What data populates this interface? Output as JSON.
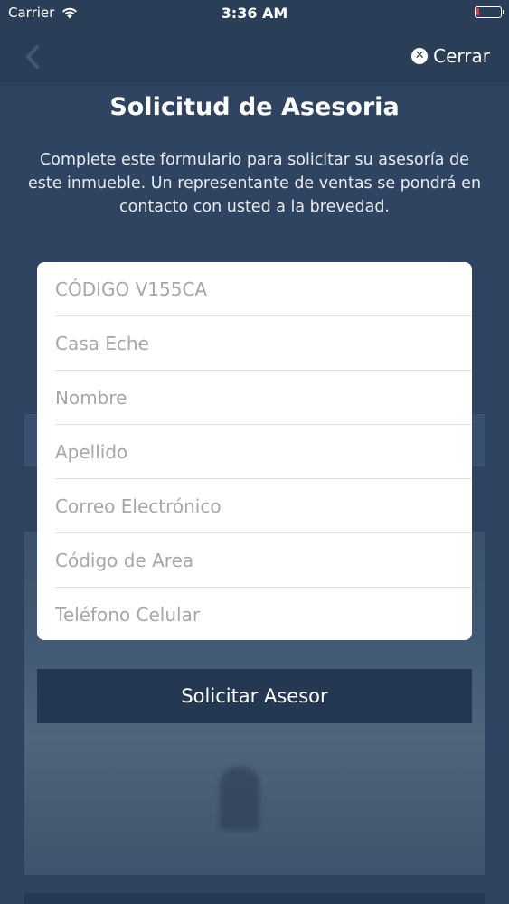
{
  "status_bar": {
    "carrier": "Carrier",
    "time": "3:36 AM",
    "battery_level": 0.1
  },
  "nav": {
    "close_label": "Cerrar",
    "back_icon": "chevron-left-icon",
    "close_icon": "close-circle-icon"
  },
  "header": {
    "title": "Solicitud de Asesoria",
    "description": "Complete este formulario para solicitar su asesoría de este inmueble. Un representante de ventas se pondrá en contacto con usted a la brevedad."
  },
  "form": {
    "code": "CÓDIGO V155CA",
    "property": "Casa Eche",
    "fields": {
      "nombre": "Nombre",
      "apellido": "Apellido",
      "correo": "Correo Electrónico",
      "codigo_area": "Código de Area",
      "telefono": "Teléfono Celular"
    },
    "submit_label": "Solicitar Asesor"
  }
}
